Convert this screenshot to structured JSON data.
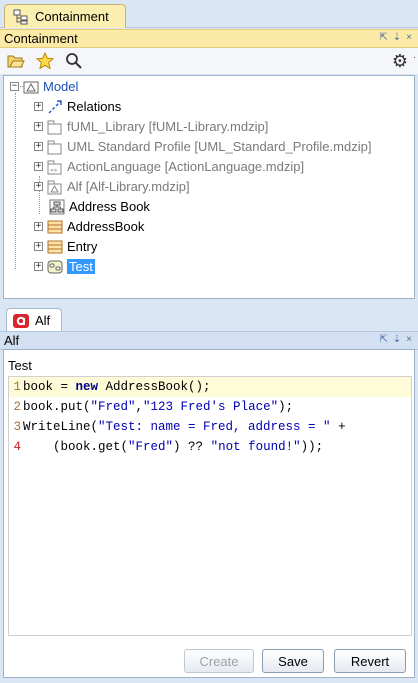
{
  "top_tab": {
    "label": "Containment"
  },
  "containment": {
    "title": "Containment",
    "controls": [
      "⇱",
      "⇣",
      "×"
    ]
  },
  "tree": [
    {
      "label": "Model",
      "style": "blue"
    },
    {
      "label": "Relations",
      "style": "normal"
    },
    {
      "label": "fUML_Library [fUML-Library.mdzip]",
      "style": "grey"
    },
    {
      "label": "UML Standard Profile [UML_Standard_Profile.mdzip]",
      "style": "grey"
    },
    {
      "label": "ActionLanguage [ActionLanguage.mdzip]",
      "style": "grey"
    },
    {
      "label": "Alf [Alf-Library.mdzip]",
      "style": "grey"
    },
    {
      "label": "Address Book",
      "style": "normal"
    },
    {
      "label": "AddressBook",
      "style": "normal"
    },
    {
      "label": "Entry",
      "style": "normal"
    },
    {
      "label": "Test",
      "style": "selected"
    }
  ],
  "alf_tab": {
    "label": "Alf"
  },
  "alf_panel": {
    "title": "Alf",
    "controls": [
      "⇱",
      "⇣",
      "×"
    ]
  },
  "editor": {
    "title": "Test",
    "line_numbers": [
      "1",
      "2",
      "3",
      "4"
    ],
    "lines": [
      {
        "pre": "book = ",
        "kw": "new",
        "rest": " AddressBook();"
      },
      {
        "pre": "book.put(",
        "s1": "\"Fred\"",
        "mid": ",",
        "s2": "\"123 Fred's Place\"",
        "post": ");"
      },
      {
        "pre": "WriteLine(",
        "s1": "\"Test: name = Fred, address = \"",
        "post": " +"
      },
      {
        "pre": "    (book.get(",
        "s1": "\"Fred\"",
        "mid": ") ?? ",
        "s2": "\"not found!\"",
        "post": "));"
      }
    ]
  },
  "buttons": {
    "create": "Create",
    "save": "Save",
    "revert": "Revert"
  },
  "colors": {
    "accent": "#fbeaa6",
    "selection": "#3399ff",
    "code_string": "#0000b3",
    "code_keyword": "#00008b"
  }
}
